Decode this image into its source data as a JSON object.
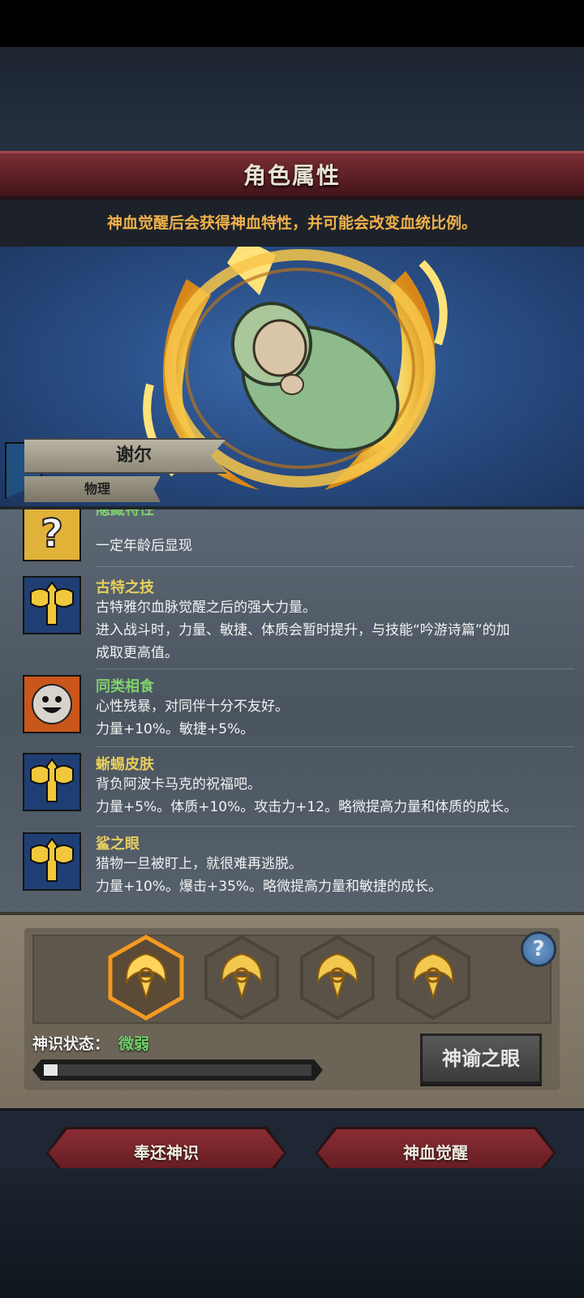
{
  "header": {
    "title": "角色属性",
    "subtitle": "神血觉醒后会获得神血特性，并可能会改变血统比例。"
  },
  "character": {
    "name": "谢尔",
    "type": "物理"
  },
  "traits": [
    {
      "icon": "question-mark-icon",
      "title": "隐藏特性",
      "title_color": "#7fd06c",
      "lines": [
        "一定年龄后显现"
      ]
    },
    {
      "icon": "axe-icon",
      "title": "古特之技",
      "title_color": "#e8cf5e",
      "lines": [
        "古特雅尔血脉觉醒之后的强大力量。",
        "进入战斗时，力量、敏捷、体质会暂时提升，与技能“吟游诗篇”的加",
        "成取更高值。"
      ]
    },
    {
      "icon": "smiley-icon",
      "title": "同类相食",
      "title_color": "#7fd06c",
      "lines": [
        "心性残暴，对同伴十分不友好。",
        "力量+10%。敏捷+5%。"
      ]
    },
    {
      "icon": "axe-icon",
      "title": "蜥蜴皮肤",
      "title_color": "#e8cf5e",
      "lines": [
        "背负阿波卡马克的祝福吧。",
        "力量+5%。体质+10%。攻击力+12。略微提高力量和体质的成长。"
      ]
    },
    {
      "icon": "axe-icon",
      "title": "鲨之眼",
      "title_color": "#e8cf5e",
      "lines": [
        "猎物一旦被盯上，就很难再逃脱。",
        "力量+10%。爆击+35%。略微提高力量和敏捷的成长。"
      ]
    }
  ],
  "divine": {
    "slots": [
      "flame-crest-icon",
      "flame-crest-icon",
      "flame-crest-icon",
      "flame-crest-icon"
    ],
    "selected_slot": 0,
    "help_label": "?",
    "status_label": "神识状态：",
    "status_value": "微弱",
    "progress": 0.05,
    "oracle_button": "神谕之眼"
  },
  "footer": {
    "return_button": "奉还神识",
    "awaken_button": "神血觉醒"
  },
  "colors": {
    "accent_gold": "#e8cf5e",
    "accent_green": "#7fd06c",
    "header_red": "#7a2e34",
    "subtitle_orange": "#f0b14a"
  }
}
